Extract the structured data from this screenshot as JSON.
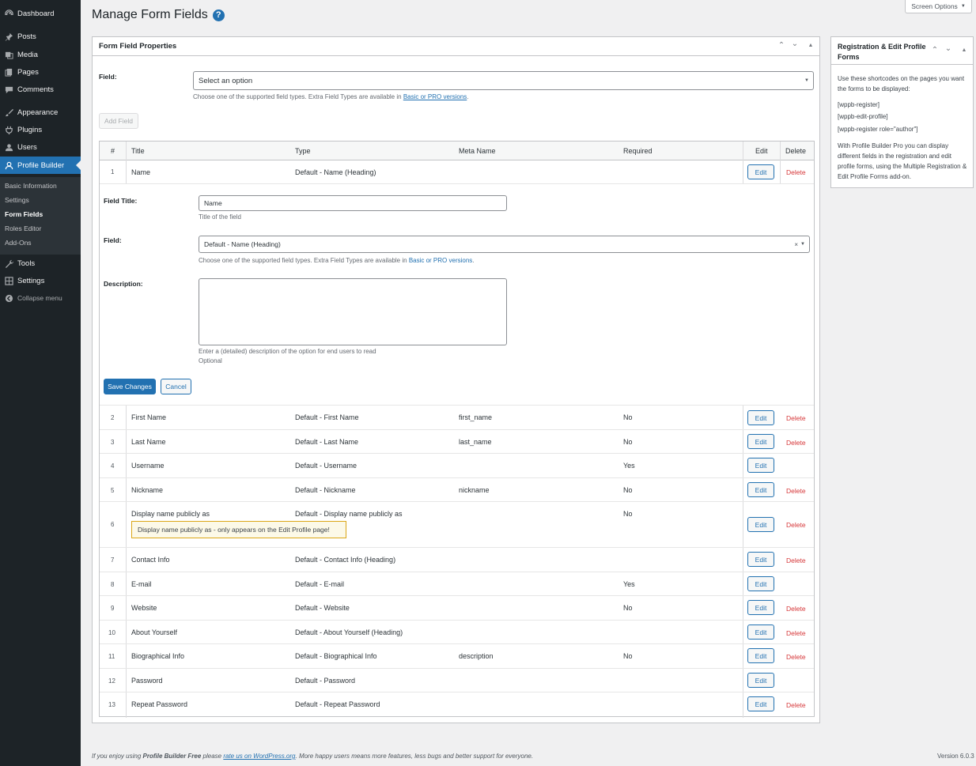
{
  "sidebar": {
    "items": [
      {
        "label": "Dashboard",
        "icon": "dashboard-icon"
      },
      {
        "label": "Posts",
        "icon": "pin-icon"
      },
      {
        "label": "Media",
        "icon": "media-icon"
      },
      {
        "label": "Pages",
        "icon": "pages-icon"
      },
      {
        "label": "Comments",
        "icon": "comment-icon"
      },
      {
        "label": "Appearance",
        "icon": "brush-icon"
      },
      {
        "label": "Plugins",
        "icon": "plug-icon"
      },
      {
        "label": "Users",
        "icon": "user-icon"
      },
      {
        "label": "Profile Builder",
        "icon": "profile-icon"
      },
      {
        "label": "Tools",
        "icon": "wrench-icon"
      },
      {
        "label": "Settings",
        "icon": "settings-icon"
      }
    ],
    "submenu": [
      "Basic Information",
      "Settings",
      "Form Fields",
      "Roles Editor",
      "Add-Ons"
    ],
    "collapse_label": "Collapse menu"
  },
  "header": {
    "title": "Manage Form Fields",
    "help": "?",
    "screen_options": "Screen Options"
  },
  "form_props": {
    "title": "Form Field Properties",
    "field_label": "Field:",
    "select_placeholder": "Select an option",
    "hint_prefix": "Choose one of the supported field types. Extra Field Types are available in",
    "hint_link": "Basic or PRO versions",
    "hint_suffix": ".",
    "add_button": "Add Field"
  },
  "table": {
    "headers": {
      "num": "#",
      "title": "Title",
      "type": "Type",
      "meta": "Meta Name",
      "required": "Required",
      "edit": "Edit",
      "delete": "Delete"
    },
    "edit_label": "Edit",
    "delete_label": "Delete",
    "rows": [
      {
        "num": "1",
        "title": "Name",
        "type": "Default - Name (Heading)",
        "meta": "",
        "required": "",
        "delete": true
      },
      {
        "num": "2",
        "title": "First Name",
        "type": "Default - First Name",
        "meta": "first_name",
        "required": "No",
        "delete": true
      },
      {
        "num": "3",
        "title": "Last Name",
        "type": "Default - Last Name",
        "meta": "last_name",
        "required": "No",
        "delete": true
      },
      {
        "num": "4",
        "title": "Username",
        "type": "Default - Username",
        "meta": "",
        "required": "Yes",
        "delete": false
      },
      {
        "num": "5",
        "title": "Nickname",
        "type": "Default - Nickname",
        "meta": "nickname",
        "required": "No",
        "delete": true
      },
      {
        "num": "6",
        "title": "Display name publicly as",
        "type": "Default - Display name publicly as",
        "meta": "",
        "required": "No",
        "delete": true,
        "notice": "Display name publicly as - only appears on the Edit Profile page!"
      },
      {
        "num": "7",
        "title": "Contact Info",
        "type": "Default - Contact Info (Heading)",
        "meta": "",
        "required": "",
        "delete": true
      },
      {
        "num": "8",
        "title": "E-mail",
        "type": "Default - E-mail",
        "meta": "",
        "required": "Yes",
        "delete": false
      },
      {
        "num": "9",
        "title": "Website",
        "type": "Default - Website",
        "meta": "",
        "required": "No",
        "delete": true
      },
      {
        "num": "10",
        "title": "About Yourself",
        "type": "Default - About Yourself (Heading)",
        "meta": "",
        "required": "",
        "delete": true
      },
      {
        "num": "11",
        "title": "Biographical Info",
        "type": "Default - Biographical Info",
        "meta": "description",
        "required": "No",
        "delete": true
      },
      {
        "num": "12",
        "title": "Password",
        "type": "Default - Password",
        "meta": "",
        "required": "",
        "delete": false
      },
      {
        "num": "13",
        "title": "Repeat Password",
        "type": "Default - Repeat Password",
        "meta": "",
        "required": "",
        "delete": true
      }
    ]
  },
  "edit_panel": {
    "title_label": "Field Title:",
    "title_value": "Name",
    "title_hint": "Title of the field",
    "field_label": "Field:",
    "field_value": "Default - Name (Heading)",
    "field_clear": "×",
    "field_hint_prefix": "Choose one of the supported field types. Extra Field Types are available in",
    "field_hint_link": "Basic or PRO versions",
    "field_hint_suffix": ".",
    "description_label": "Description:",
    "description_value": "",
    "description_hint": "Enter a (detailed) description of the option for end users to read",
    "optional": "Optional",
    "save": "Save Changes",
    "cancel": "Cancel"
  },
  "sidebox": {
    "title": "Registration & Edit Profile Forms",
    "intro": "Use these shortcodes on the pages you want the forms to be displayed:",
    "shortcodes": [
      "[wppb-register]",
      "[wppb-edit-profile]",
      "[wppb-register role=\"author\"]"
    ],
    "outro": "With Profile Builder Pro you can display different fields in the registration and edit profile forms, using the Multiple Registration & Edit Profile Forms add-on."
  },
  "footer": {
    "text_1": "If you enjoy using",
    "bold": "Profile Builder Free",
    "text_2": "please",
    "link": "rate us on WordPress.org",
    "text_3": ". More happy users means more features, less bugs and better support for everyone.",
    "version": "Version 6.0.3"
  },
  "colors": {
    "accent": "#2271b1",
    "delete": "#d63638",
    "sidebar_bg": "#1d2327",
    "notice_border": "#dba617"
  }
}
